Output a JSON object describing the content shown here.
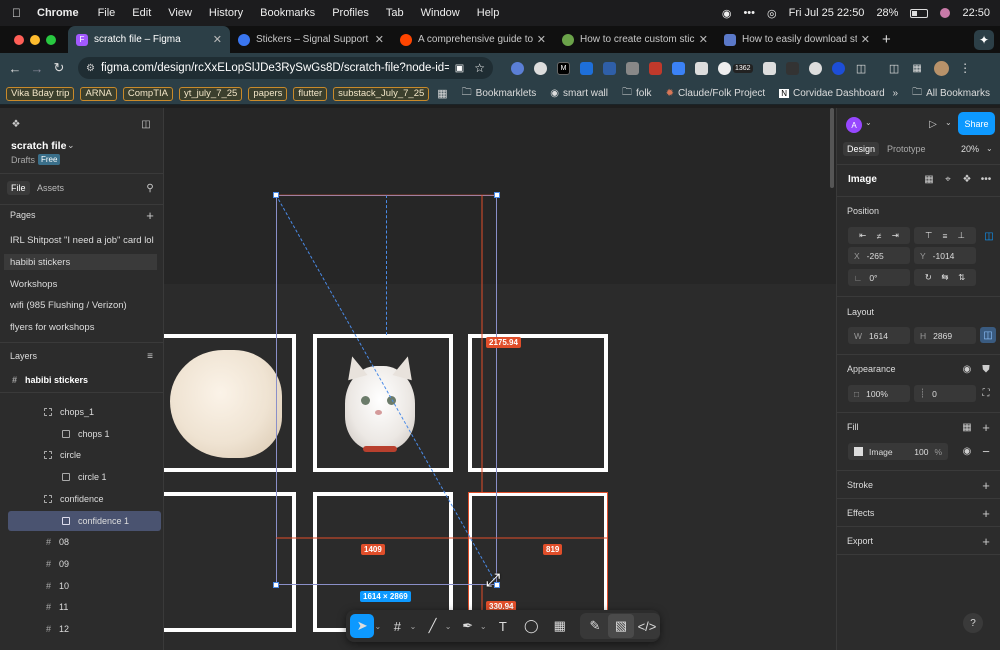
{
  "menubar": {
    "app": "Chrome",
    "items": [
      "File",
      "Edit",
      "View",
      "History",
      "Bookmarks",
      "Profiles",
      "Tab",
      "Window",
      "Help"
    ],
    "date": "Fri Jul 25  22:50",
    "battery": "28%",
    "time": "22:50"
  },
  "tabs": [
    {
      "title": "scratch file – Figma",
      "color": "#a259ff"
    },
    {
      "title": "Stickers – Signal Support",
      "color": "#3a76f0"
    },
    {
      "title": "A comprehensive guide to fin",
      "color": "#ff4500"
    },
    {
      "title": "How to create custom sticker",
      "color": "#6ba34a"
    },
    {
      "title": "How to easily download stick",
      "color": "#5b79c9"
    }
  ],
  "address": {
    "url": "figma.com/design/rcXxELopSlJDe3RySwGs8D/scratch-file?node-id=322-...",
    "badge_count": "1362"
  },
  "bookmarks": {
    "tags": [
      "Vika Bday trip",
      "ARNA",
      "CompTIA",
      "yt_july_7_25",
      "papers",
      "flutter",
      "substack_July_7_25"
    ],
    "folders": [
      "Bookmarklets",
      "smart wall",
      "folk",
      "Claude/Folk Project",
      "Corvidae Dashboard"
    ],
    "all": "All Bookmarks"
  },
  "left": {
    "file_name": "scratch file",
    "drafts": "Drafts",
    "plan": "Free",
    "tab_file": "File",
    "tab_assets": "Assets",
    "pages_title": "Pages",
    "pages": [
      "IRL Shitpost \"I need a job\" card lol",
      "habibi stickers",
      "Workshops",
      "wifi (985 Flushing / Verizon)",
      "flyers for workshops"
    ],
    "layers_title": "Layers",
    "layers_page": "habibi stickers",
    "layers": [
      {
        "name": "chops_1",
        "kind": "group",
        "indent": 1
      },
      {
        "name": "chops 1",
        "kind": "image",
        "indent": 2
      },
      {
        "name": "circle",
        "kind": "group",
        "indent": 1
      },
      {
        "name": "circle 1",
        "kind": "image",
        "indent": 2
      },
      {
        "name": "confidence",
        "kind": "group",
        "indent": 1
      },
      {
        "name": "confidence 1",
        "kind": "image",
        "indent": 2,
        "selected": true
      },
      {
        "name": "08",
        "kind": "frame",
        "indent": 1
      },
      {
        "name": "09",
        "kind": "frame",
        "indent": 1
      },
      {
        "name": "10",
        "kind": "frame",
        "indent": 1
      },
      {
        "name": "11",
        "kind": "frame",
        "indent": 1
      },
      {
        "name": "12",
        "kind": "frame",
        "indent": 1
      }
    ]
  },
  "right": {
    "avatar": "A",
    "share": "Share",
    "tab_design": "Design",
    "tab_prototype": "Prototype",
    "zoom": "20%",
    "selection": "Image",
    "position_title": "Position",
    "x_label": "X",
    "x": "-265",
    "y_label": "Y",
    "y": "-1014",
    "rotation": "0°",
    "layout_title": "Layout",
    "w_label": "W",
    "w": "1614",
    "h_label": "H",
    "h": "2869",
    "appearance_title": "Appearance",
    "opacity": "100%",
    "radius": "0",
    "fill_title": "Fill",
    "fill_type": "Image",
    "fill_opacity": "100",
    "fill_pct": "%",
    "stroke": "Stroke",
    "effects": "Effects",
    "export": "Export",
    "help": "?"
  },
  "canvas": {
    "measure_top": "2175.94",
    "measure_left": "1409",
    "measure_right": "819",
    "measure_bottom": "330.94",
    "size": "1614 × 2869"
  },
  "colors": {
    "accent": "#0d99ff",
    "measure": "#e04e2a",
    "selection": "#4a8be8"
  }
}
